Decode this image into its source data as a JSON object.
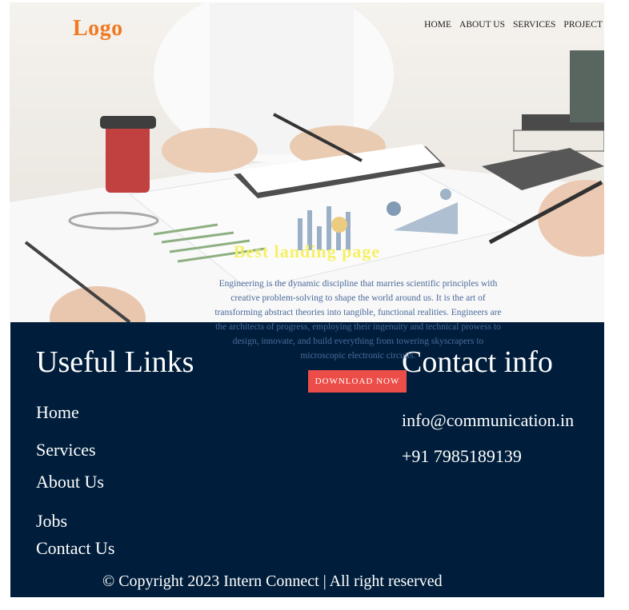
{
  "header": {
    "logo": "Logo",
    "nav": [
      "HOME",
      "ABOUT US",
      "SERVICES",
      "PROJECT"
    ]
  },
  "hero": {
    "title": "Best landing page",
    "text": "Engineering is the dynamic discipline that marries scientific principles with creative problem-solving to shape the world around us. It is the art of transforming abstract theories into tangible, functional realities. Engineers are the architects of progress, employing their ingenuity and technical prowess to design, innovate, and build everything from towering skyscrapers to microscopic electronic circuits.",
    "button": "DOWNLOAD NOW"
  },
  "footer": {
    "links_title": "Useful Links",
    "links": [
      "Home",
      "Services",
      "About Us",
      "Jobs",
      "Contact Us"
    ],
    "contact_title": "Contact info",
    "email": "info@communication.in",
    "phone": "+91 7985189139",
    "copyright": "© Copyright 2023 Intern Connect | All right reserved"
  },
  "colors": {
    "logo": "#f07a22",
    "hero_title": "#f6f066",
    "button": "#ec4d48",
    "footer_bg": "#001e3b"
  }
}
